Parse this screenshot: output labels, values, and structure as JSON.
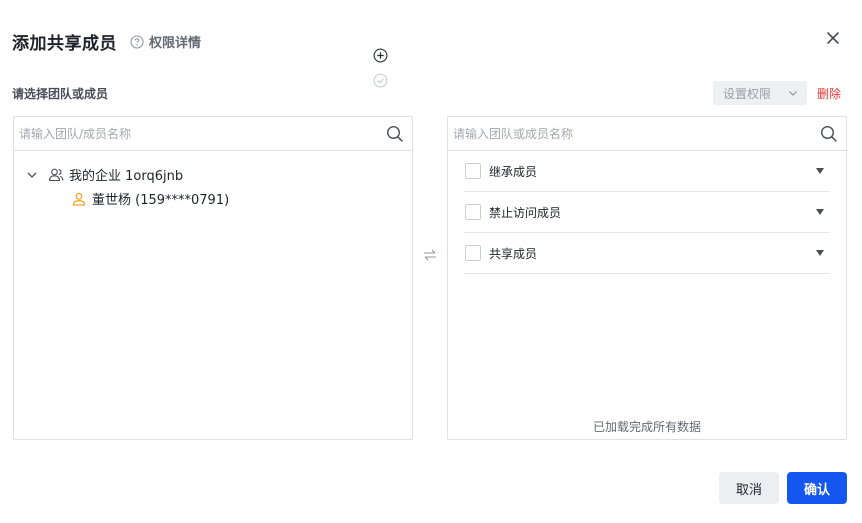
{
  "dialog": {
    "title": "添加共享成员",
    "permission_help": "权限详情",
    "colors": {
      "primary": "#1456f0",
      "danger": "#e53935"
    }
  },
  "toolbar": {
    "select_label": "请选择团队或成员",
    "permission_select": "设置权限",
    "delete_label": "删除"
  },
  "left_panel": {
    "search_placeholder": "请输入团队/成员名称",
    "org_name": "我的企业 1orq6jnb",
    "member_name": "董世杨 (159****0791)"
  },
  "right_panel": {
    "search_placeholder": "请输入团队或成员名称",
    "roles": [
      {
        "label": "继承成员"
      },
      {
        "label": "禁止访问成员"
      },
      {
        "label": "共享成员"
      }
    ],
    "status": "已加载完成所有数据"
  },
  "footer": {
    "cancel_label": "取消",
    "confirm_label": "确认"
  }
}
